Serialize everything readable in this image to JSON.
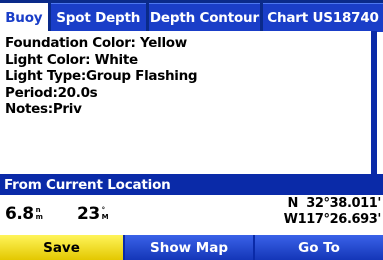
{
  "tabs": [
    {
      "label": "Buoy",
      "active": true
    },
    {
      "label": "Spot Depth",
      "active": false
    },
    {
      "label": "Depth Contour",
      "active": false
    },
    {
      "label": "Chart US18740",
      "active": false
    }
  ],
  "info": {
    "lines": [
      "Foundation Color: Yellow",
      "Light Color: White",
      "Light Type:Group Flashing",
      "Period:20.0s",
      "Notes:Priv"
    ]
  },
  "location": {
    "header": "From Current Location",
    "distance_value": "6.8",
    "distance_unit_top": "n",
    "distance_unit_bottom": "m",
    "bearing_value": "23",
    "bearing_unit_top": "°",
    "bearing_unit_bottom": "M",
    "lat": "N  32°38.011'",
    "lon": "W117°26.693'"
  },
  "buttons": {
    "save": "Save",
    "show_map": "Show Map",
    "go_to": "Go To"
  },
  "colors": {
    "frame_blue": "#0a2aa8",
    "tab_blue": "#1a3ec8",
    "selected_yellow": "#f5e200"
  }
}
